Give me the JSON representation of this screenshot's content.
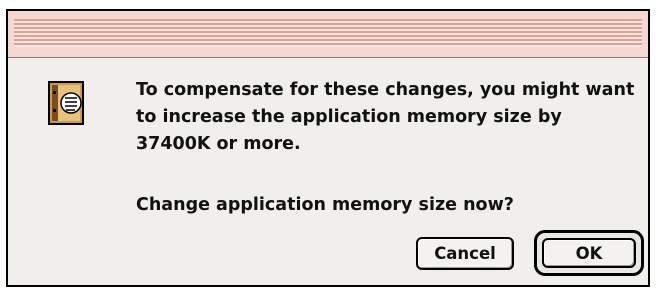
{
  "dialog": {
    "icon": "note-icon",
    "message": "To compensate for these changes, you might want to increase the application memory size by 37400K or more.",
    "question": "Change application memory size now?",
    "buttons": {
      "cancel_label": "Cancel",
      "ok_label": "OK"
    }
  },
  "colors": {
    "title_stripe": "#e79c92",
    "title_bg": "#f6d8d3",
    "dialog_bg": "#f1efec"
  }
}
